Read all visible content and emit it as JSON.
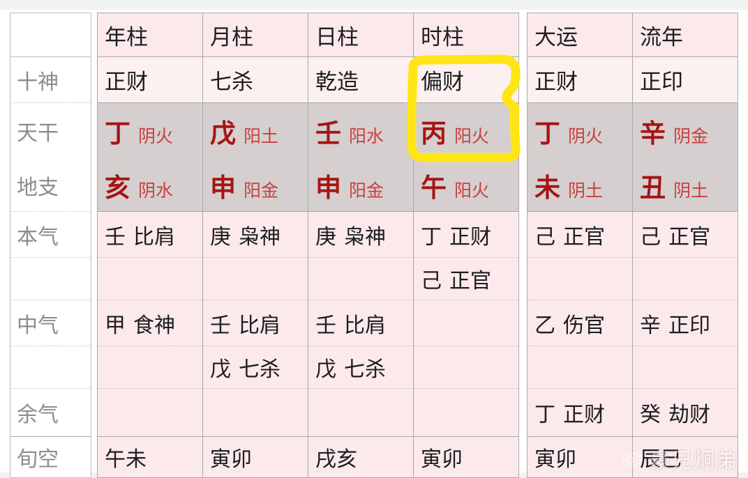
{
  "table": {
    "row_labels": [
      "",
      "十神",
      "天干",
      "地支",
      "本气",
      "",
      "中气",
      "",
      "余气",
      "旬空"
    ],
    "pillar_headers": [
      "年柱",
      "月柱",
      "日柱",
      "时柱"
    ],
    "luck_headers": [
      "大运",
      "流年"
    ],
    "ten_gods": {
      "year": "正财",
      "month": "七杀",
      "day": "乾造",
      "hour": "偏财",
      "luck": "正财",
      "annual": "正印"
    },
    "heavenly_stems": [
      {
        "char": "丁",
        "element": "阴火"
      },
      {
        "char": "戊",
        "element": "阳土"
      },
      {
        "char": "壬",
        "element": "阳水"
      },
      {
        "char": "丙",
        "element": "阳火"
      },
      {
        "char": "丁",
        "element": "阴火"
      },
      {
        "char": "辛",
        "element": "阴金"
      }
    ],
    "earthly_branches": [
      {
        "char": "亥",
        "element": "阴水"
      },
      {
        "char": "申",
        "element": "阳金"
      },
      {
        "char": "申",
        "element": "阳金"
      },
      {
        "char": "午",
        "element": "阳火"
      },
      {
        "char": "未",
        "element": "阴土"
      },
      {
        "char": "丑",
        "element": "阴土"
      }
    ],
    "benqi": [
      {
        "stem": "壬",
        "god": "比肩"
      },
      {
        "stem": "庚",
        "god": "枭神"
      },
      {
        "stem": "庚",
        "god": "枭神"
      },
      {
        "stem": "丁",
        "god": "正财"
      },
      {
        "stem": "己",
        "god": "正官"
      },
      {
        "stem": "己",
        "god": "正官"
      }
    ],
    "benqi_second": [
      {
        "stem": "",
        "god": ""
      },
      {
        "stem": "",
        "god": ""
      },
      {
        "stem": "",
        "god": ""
      },
      {
        "stem": "己",
        "god": "正官"
      },
      {
        "stem": "",
        "god": ""
      },
      {
        "stem": "",
        "god": ""
      }
    ],
    "zhongqi": [
      {
        "stem": "甲",
        "god": "食神"
      },
      {
        "stem": "壬",
        "god": "比肩"
      },
      {
        "stem": "壬",
        "god": "比肩"
      },
      {
        "stem": "",
        "god": ""
      },
      {
        "stem": "乙",
        "god": "伤官"
      },
      {
        "stem": "辛",
        "god": "正印"
      }
    ],
    "zhongqi_second": [
      {
        "stem": "",
        "god": ""
      },
      {
        "stem": "戊",
        "god": "七杀"
      },
      {
        "stem": "戊",
        "god": "七杀"
      },
      {
        "stem": "",
        "god": ""
      },
      {
        "stem": "",
        "god": ""
      },
      {
        "stem": "",
        "god": ""
      }
    ],
    "yuqi": [
      {
        "stem": "",
        "god": ""
      },
      {
        "stem": "",
        "god": ""
      },
      {
        "stem": "",
        "god": ""
      },
      {
        "stem": "",
        "god": ""
      },
      {
        "stem": "丁",
        "god": "正财"
      },
      {
        "stem": "癸",
        "god": "劫财"
      }
    ],
    "xunkong": [
      "午未",
      "寅卯",
      "戌亥",
      "寅卯",
      "寅卯",
      "辰巳"
    ]
  },
  "annotation": {
    "shape": "hand-drawn-rectangle",
    "color": "#ffe515",
    "target": "时柱 偏财 / 丙 阳火"
  },
  "watermark": {
    "text": "豪兄炯弟",
    "logo": "weibo-icon"
  },
  "colors": {
    "stem_red": "#a51414",
    "element_red": "#c9403f",
    "pillar_bg": "#fbe9ec",
    "stem_row_bg": "#d5cfcf",
    "border": "#a9a9a9",
    "label_text": "#8c8c8c",
    "highlight": "#ffe515"
  }
}
